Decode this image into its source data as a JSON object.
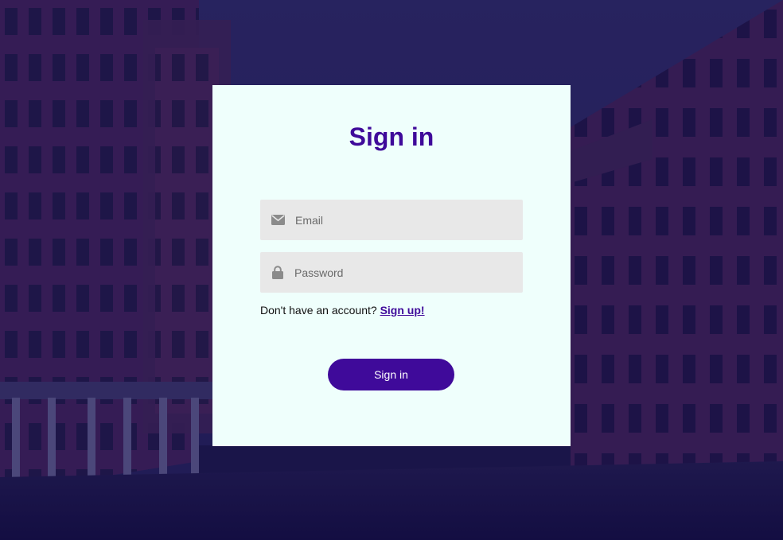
{
  "form": {
    "title": "Sign in",
    "email": {
      "placeholder": "Email",
      "value": "",
      "icon": "envelope-icon"
    },
    "password": {
      "placeholder": "Password",
      "value": "",
      "icon": "lock-icon"
    },
    "signup_prompt": "Don't have an account?",
    "signup_link": "Sign up!",
    "submit_label": "Sign in"
  },
  "colors": {
    "accent": "#3f0a9a",
    "card_background": "#effffc",
    "field_background": "#e8e8e8",
    "page_overlay": "#1c1450"
  }
}
